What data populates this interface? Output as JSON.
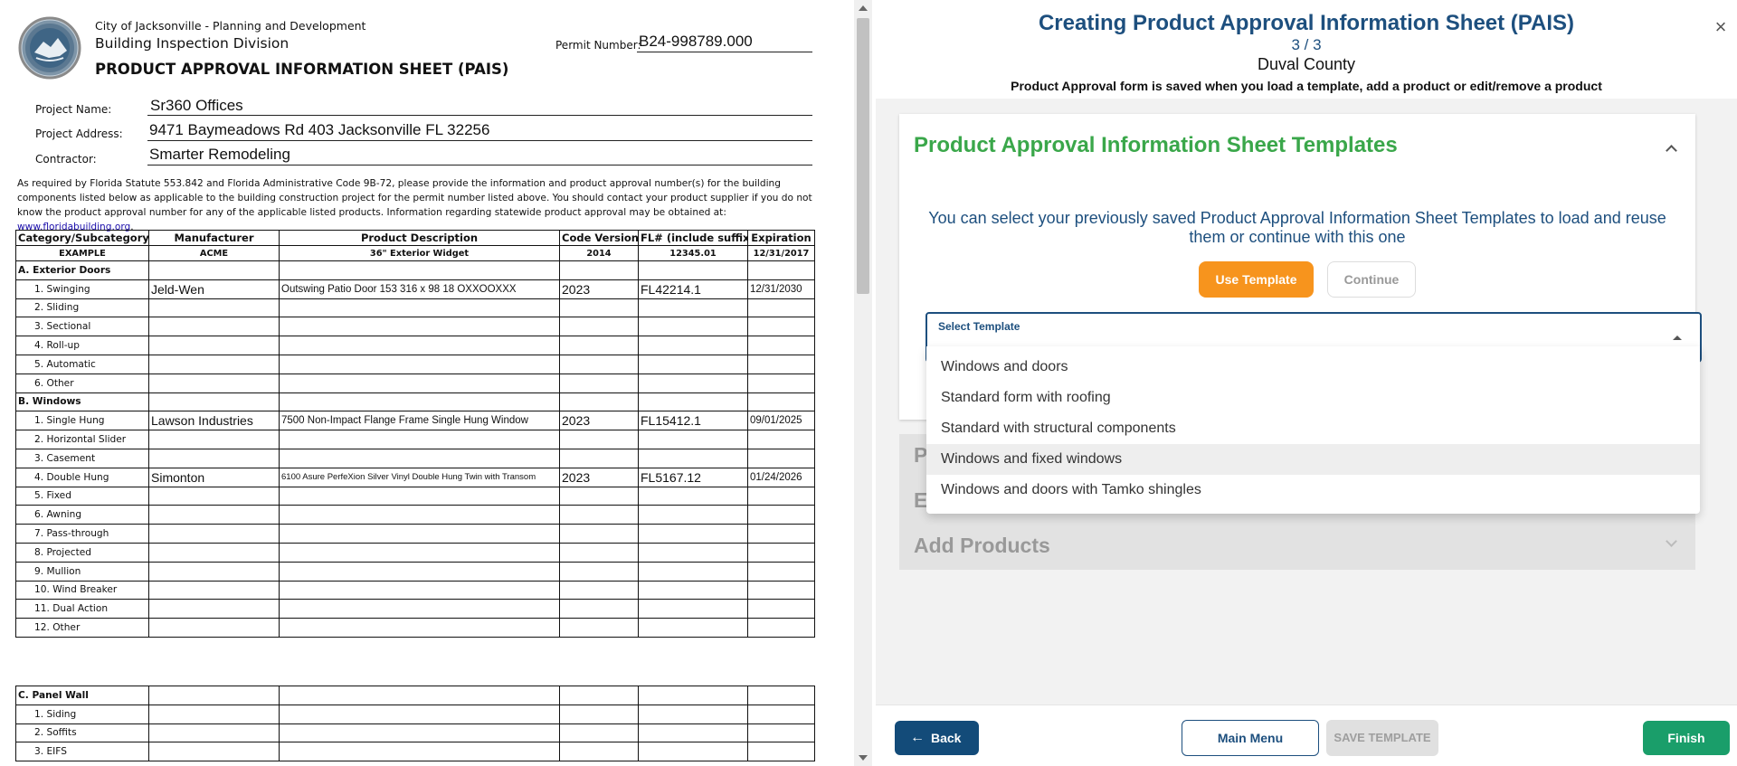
{
  "document": {
    "city": "City of Jacksonville - Planning and Development",
    "division": "Building Inspection Division",
    "form_title": "PRODUCT APPROVAL INFORMATION SHEET (PAIS)",
    "permit_label": "Permit Number:",
    "permit_value": "B24-998789.000",
    "fields": [
      {
        "label": "Project Name:",
        "value": "Sr360 Offices"
      },
      {
        "label": "Project Address:",
        "value": "9471 Baymeadows Rd 403 Jacksonville FL 32256"
      },
      {
        "label": "Contractor:",
        "value": "Smarter Remodeling"
      }
    ],
    "statute_text": "As required by Florida Statute 553.842 and Florida Administrative Code 9B-72, please provide the information and product approval number(s) for the building components listed below as applicable to the building construction project for the permit number listed above. You should contact your product supplier if you do not know the product approval number for any of the applicable listed products. Information regarding statewide product approval may be obtained at:",
    "statute_link": "www.floridabuilding.org",
    "statute_end": ".",
    "headers": [
      "Category/Subcategory",
      "Manufacturer",
      "Product Description",
      "Code Version",
      "FL# (include suffix)",
      "Expiration"
    ],
    "example": [
      "EXAMPLE",
      "ACME",
      "36\" Exterior Widget",
      "2014",
      "12345.01",
      "12/31/2017"
    ],
    "section_a": {
      "title": "A. Exterior Doors",
      "rows": [
        {
          "name": "1. Swinging",
          "manufacturer": "Jeld-Wen",
          "description": "Outswing Patio Door 153 316 x 98 18 OXXOOXXX",
          "code": "2023",
          "fl": "FL42214.1",
          "exp": "12/31/2030"
        },
        {
          "name": "2. Sliding"
        },
        {
          "name": "3. Sectional"
        },
        {
          "name": "4. Roll-up"
        },
        {
          "name": "5. Automatic"
        },
        {
          "name": "6. Other"
        }
      ]
    },
    "section_b": {
      "title": "B. Windows",
      "rows": [
        {
          "name": "1. Single Hung",
          "manufacturer": "Lawson Industries",
          "description": "7500 Non-Impact Flange Frame Single Hung Window",
          "code": "2023",
          "fl": "FL15412.1",
          "exp": "09/01/2025"
        },
        {
          "name": "2. Horizontal Slider"
        },
        {
          "name": "3. Casement"
        },
        {
          "name": "4. Double Hung",
          "manufacturer": "Simonton",
          "description": "6100 Asure PerfeXion Silver Vinyl Double Hung Twin with Transom",
          "code": "2023",
          "fl": "FL5167.12",
          "exp": "01/24/2026"
        },
        {
          "name": "5. Fixed"
        },
        {
          "name": "6. Awning"
        },
        {
          "name": "7. Pass-through"
        },
        {
          "name": "8. Projected"
        },
        {
          "name": "9. Mullion"
        },
        {
          "name": "10. Wind Breaker"
        },
        {
          "name": "11. Dual Action"
        },
        {
          "name": "12. Other"
        }
      ]
    },
    "section_c": {
      "title": "C. Panel Wall",
      "rows": [
        {
          "name": "1. Siding"
        },
        {
          "name": "2. Soffits"
        },
        {
          "name": "3. EIFS"
        }
      ]
    }
  },
  "panel": {
    "title": "Creating Product Approval Information Sheet (PAIS)",
    "step": "3 / 3",
    "county": "Duval County",
    "note": "Product Approval form is saved when you load a template, add a product or edit/remove a product",
    "close_icon": "×",
    "templates_card": {
      "title": "Product Approval Information Sheet Templates",
      "description": "You can select your previously saved Product Approval Information Sheet Templates to load and reuse them or continue with this one",
      "use_button": "Use Template",
      "continue_button": "Continue",
      "select_label": "Select Template",
      "select_value": ""
    },
    "collapsed_sections": [
      {
        "title": "P"
      },
      {
        "title": "E"
      },
      {
        "title": "Add Products"
      }
    ],
    "dropdown_options": [
      "Windows and doors",
      "Standard form with roofing",
      "Standard with structural components",
      "Windows and fixed windows",
      "Windows and doors with Tamko shingles"
    ],
    "highlighted_option": "Windows and fixed windows",
    "footer": {
      "back": "Back",
      "back_icon": "←",
      "main_menu": "Main Menu",
      "save_template": "SAVE TEMPLATE",
      "finish": "Finish"
    }
  },
  "colors": {
    "primary_navy": "#1d4f7e",
    "accent_green": "#3aa74a",
    "orange": "#f7941d",
    "finish_green": "#1a9e6a"
  }
}
